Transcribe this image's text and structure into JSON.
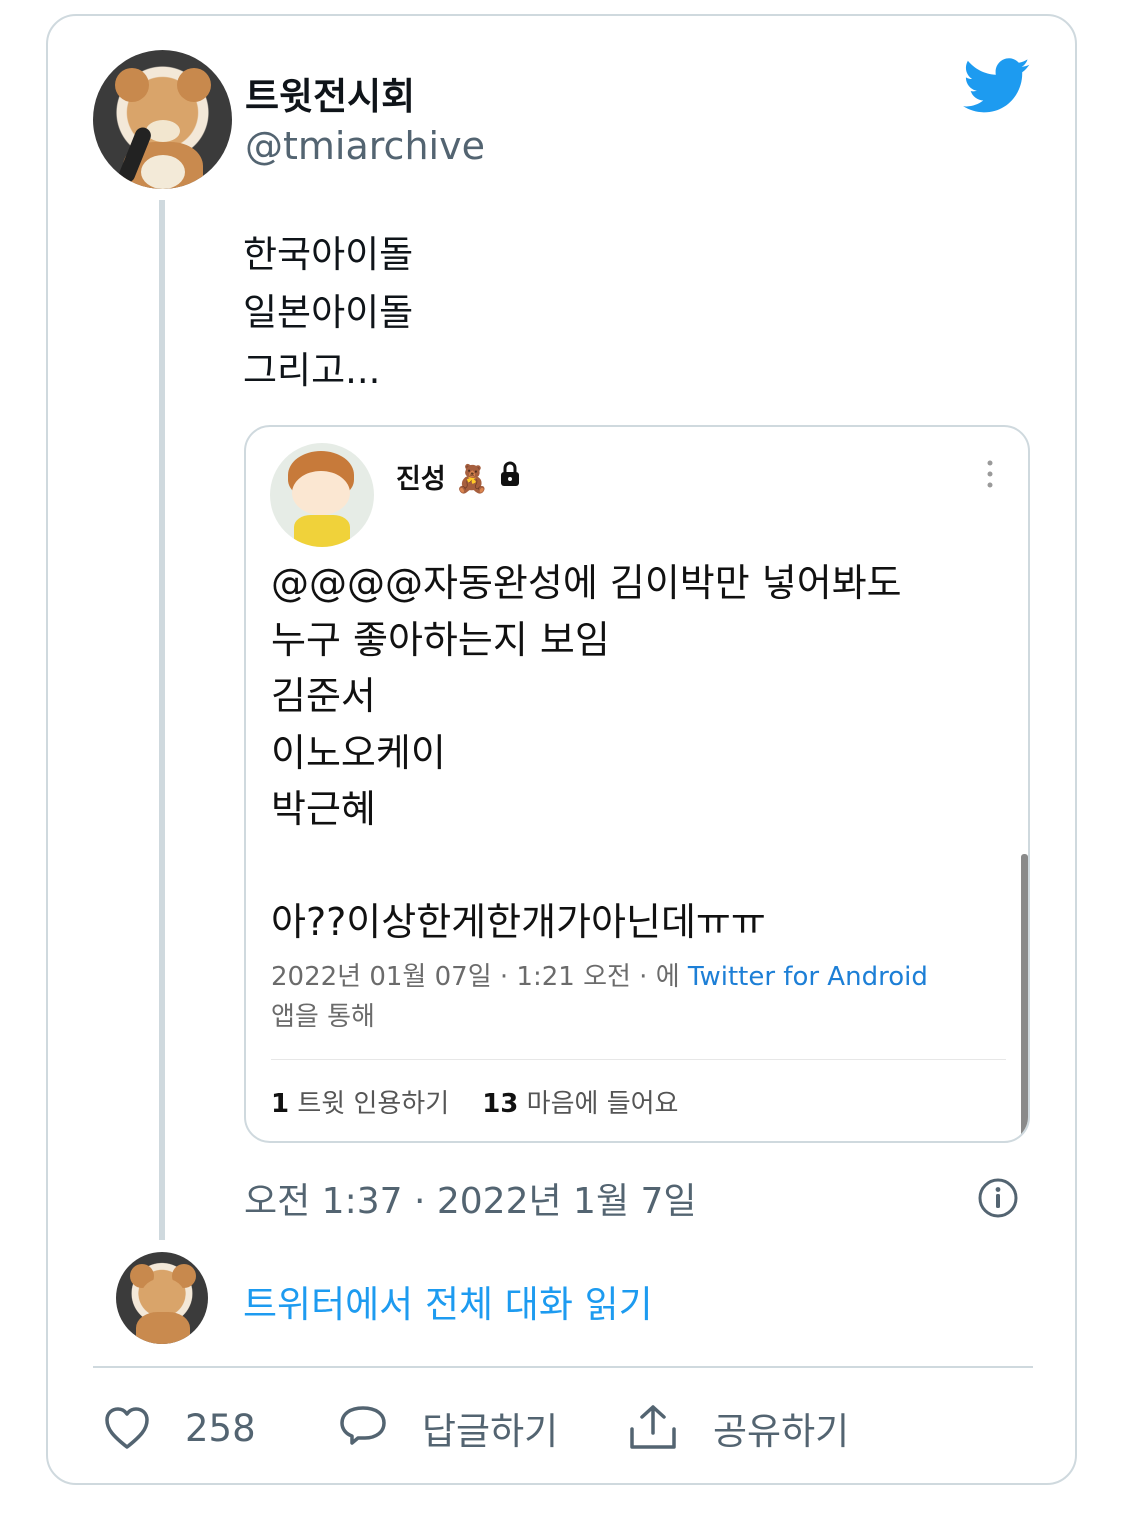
{
  "author": {
    "display_name": "트윗전시회",
    "handle": "@tmiarchive"
  },
  "tweet": {
    "lines": [
      "한국아이돌",
      "일본아이돌",
      "그리고..."
    ],
    "timestamp": "오전 1:37 · 2022년 1월 7일"
  },
  "quoted_tweet": {
    "name": "진성",
    "lines": [
      "@@@@자동완성에 김이박만 넣어봐도",
      "누구 좋아하는지 보임",
      "김준서",
      "이노오케이",
      "박근혜",
      "",
      "아??이상한게한개가아닌데ㅠㅠ"
    ],
    "meta_date": "2022년 01월 07일 · 1:21 오전 · 에",
    "meta_source": "Twitter for Android",
    "meta_suffix": "앱을 통해",
    "retweet_count": "1",
    "retweet_label": "트윗 인용하기",
    "like_count": "13",
    "like_label": "마음에 들어요"
  },
  "conversation_link": "트위터에서 전체 대화 읽기",
  "actions": {
    "likes": "258",
    "reply_label": "답글하기",
    "share_label": "공유하기"
  },
  "colors": {
    "twitter_blue": "#1d9bf0",
    "secondary_text": "#536471",
    "border": "#cfd9de"
  },
  "icons": [
    "twitter-bird-icon",
    "lock-icon",
    "more-vertical-icon",
    "info-icon",
    "heart-icon",
    "reply-bubble-icon",
    "share-icon"
  ]
}
